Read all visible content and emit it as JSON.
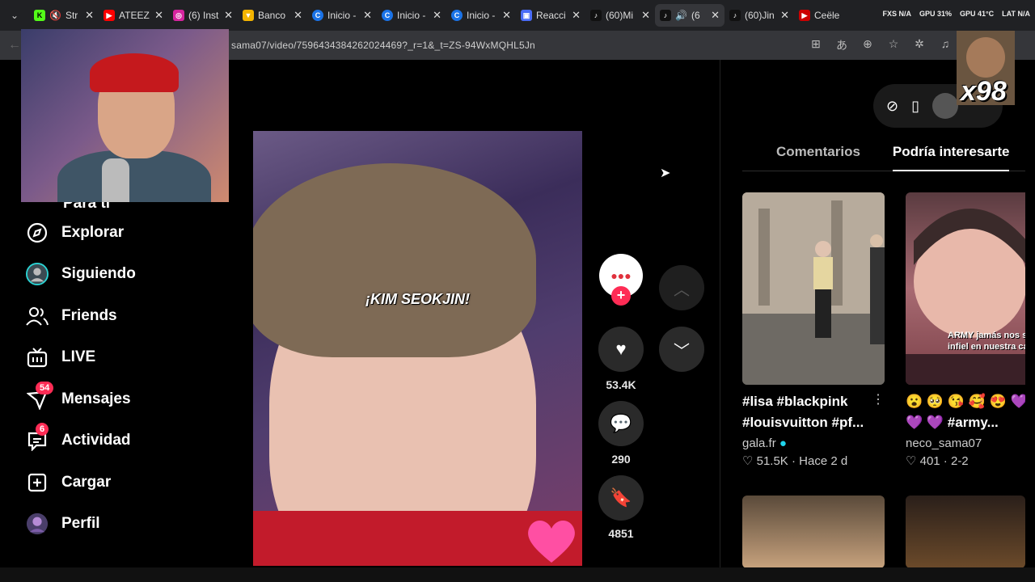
{
  "browser": {
    "tabs": [
      {
        "title": "Str",
        "favicon": "kick-icon",
        "color": "#53fc18"
      },
      {
        "title": "ATEEZ",
        "favicon": "youtube-icon",
        "color": "#ff0000"
      },
      {
        "title": "(6) Inst",
        "favicon": "instagram-icon",
        "color": "#d6249f"
      },
      {
        "title": "Banco",
        "favicon": "bank-icon",
        "color": "#f4b400"
      },
      {
        "title": "Inicio -",
        "favicon": "site-icon",
        "color": "#1a73e8"
      },
      {
        "title": "Inicio -",
        "favicon": "site-icon",
        "color": "#1a73e8"
      },
      {
        "title": "Inicio -",
        "favicon": "site-icon",
        "color": "#1a73e8"
      },
      {
        "title": "Reacci",
        "favicon": "doc-icon",
        "color": "#4a6cf7"
      },
      {
        "title": "(60)Mi",
        "favicon": "tiktok-icon",
        "color": "#111111"
      },
      {
        "title": "(6",
        "favicon": "tiktok-icon",
        "color": "#111111"
      },
      {
        "title": "(60)Jin",
        "favicon": "tiktok-icon",
        "color": "#111111"
      },
      {
        "title": "Ceële",
        "favicon": "youtube-icon",
        "color": "#cc0000"
      }
    ],
    "stats": [
      "FXS N/A",
      "GPU 31%",
      "GPU 41°C",
      "LAT N/A"
    ],
    "url": "sama07/video/7596434384262024469?_r=1&_t=ZS-94WxMQHL5Jn"
  },
  "sidebar": {
    "partial_label": "Para ti",
    "items": [
      {
        "label": "Explorar",
        "icon": "compass-icon"
      },
      {
        "label": "Siguiendo",
        "icon": "avatar-icon"
      },
      {
        "label": "Friends",
        "icon": "friends-icon"
      },
      {
        "label": "LIVE",
        "icon": "live-tv-icon"
      },
      {
        "label": "Mensajes",
        "icon": "message-icon",
        "badge": "54"
      },
      {
        "label": "Actividad",
        "icon": "activity-icon",
        "badge": "6"
      },
      {
        "label": "Cargar",
        "icon": "upload-icon"
      },
      {
        "label": "Perfil",
        "icon": "profile-avatar"
      }
    ]
  },
  "video": {
    "caption": "¡KIM SEOKJIN!"
  },
  "actions": {
    "likes": "53.4K",
    "comments": "290",
    "saves": "4851"
  },
  "right_panel": {
    "tabs": [
      "Comentarios",
      "Podría interesarte"
    ],
    "cards": [
      {
        "title_line1": "#lisa #blackpink",
        "title_line2": "#louisvuitton #pf...",
        "author": "gala.fr",
        "verified": true,
        "stats": "♡ 51.5K · Hace 2 d"
      },
      {
        "title_line1": "😮 🥺 😘 🥰 😍 💜",
        "title_line2": "💜 💜 #army...",
        "author": "neco_sama07",
        "verified": false,
        "stats": "♡ 401 · 2-2",
        "thumb_text": "ARMY jamás nos sería infiel en nuestra cara"
      }
    ]
  },
  "overlay": {
    "multiplier": "x98"
  }
}
